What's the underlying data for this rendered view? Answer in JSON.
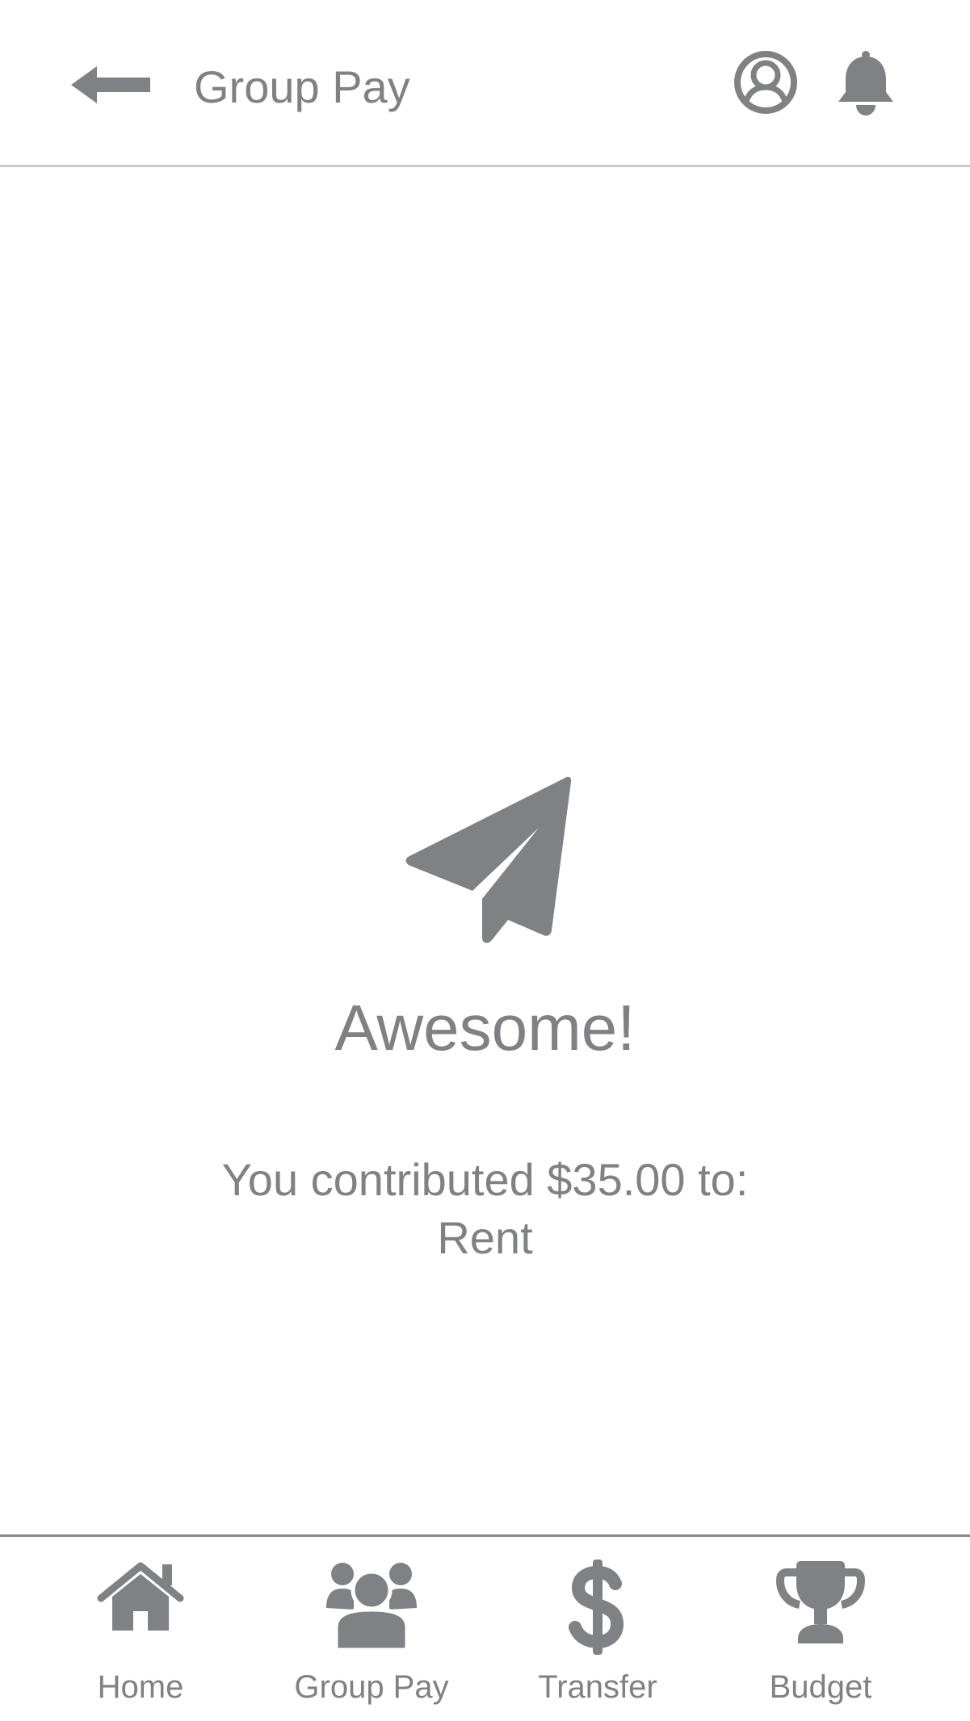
{
  "header": {
    "title": "Group Pay",
    "back_icon": "arrow-left-icon",
    "profile_icon": "user-circle-icon",
    "notification_icon": "bell-icon"
  },
  "confirmation": {
    "icon": "paper-plane-icon",
    "title": "Awesome!",
    "message_line1": "You contributed $35.00 to:",
    "message_line2": "Rent"
  },
  "bottom_nav": {
    "items": [
      {
        "label": "Home",
        "icon": "house-icon"
      },
      {
        "label": "Group Pay",
        "icon": "users-icon"
      },
      {
        "label": "Transfer",
        "icon": "dollar-icon"
      },
      {
        "label": "Budget",
        "icon": "trophy-icon"
      }
    ]
  },
  "colors": {
    "icon_gray": "#808184",
    "text_gray": "#808184",
    "divider_light": "#c9c9cb",
    "divider_dark": "#8a8a8c",
    "background": "#ffffff"
  }
}
